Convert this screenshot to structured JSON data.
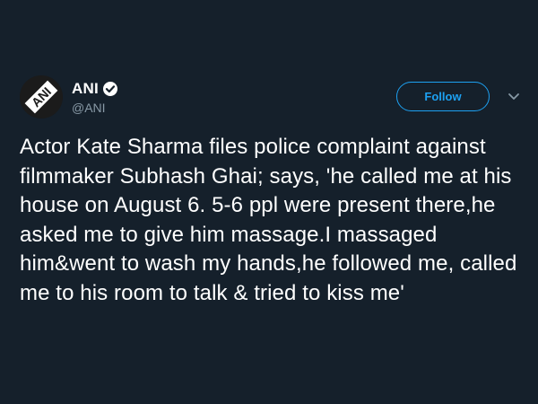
{
  "tweet": {
    "author": {
      "display_name": "ANI",
      "handle": "@ANI",
      "verified": true,
      "avatar_text": "ANI",
      "avatar_icon": "ani-logo-icon"
    },
    "follow_label": "Follow",
    "menu_icon": "chevron-down-icon",
    "text": "Actor Kate Sharma files police complaint against filmmaker Subhash Ghai; says, 'he called me at his house on August 6. 5-6 ppl were present there,he asked me to give him massage.I massaged him&went to wash my hands,he followed me, called me to his room to talk & tried to kiss me'"
  },
  "colors": {
    "background": "#15202b",
    "accent": "#1da1f2",
    "text_primary": "#ffffff",
    "text_secondary": "#8899a6",
    "avatar_bg": "#1b1b1b"
  }
}
